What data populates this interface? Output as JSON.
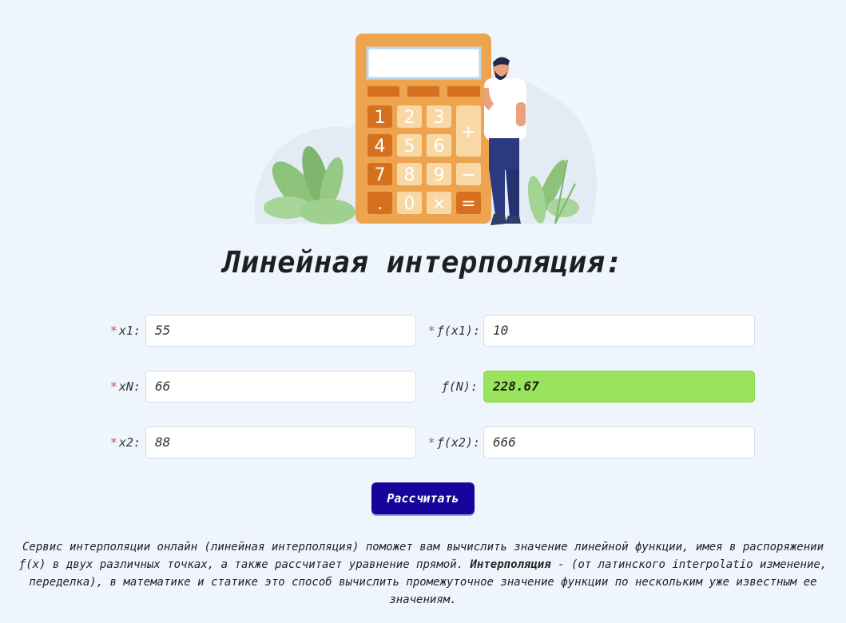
{
  "page": {
    "title": "Линейная интерполяция:"
  },
  "form": {
    "x1": {
      "label": "x1:",
      "required": "*",
      "value": "55"
    },
    "fx1": {
      "label": "ƒ(x1):",
      "required": "*",
      "value": "10"
    },
    "xN": {
      "label": "xN:",
      "required": "*",
      "value": "66"
    },
    "fN": {
      "label": "ƒ(N):",
      "value": "228.67"
    },
    "x2": {
      "label": "x2:",
      "required": "*",
      "value": "88"
    },
    "fx2": {
      "label": "ƒ(x2):",
      "required": "*",
      "value": "666"
    },
    "submit_label": "Рассчитать"
  },
  "calculator_keys": [
    "1",
    "2",
    "3",
    "+",
    "4",
    "5",
    "6",
    "7",
    "8",
    "9",
    "−",
    ".",
    "0",
    "×",
    "="
  ],
  "description": {
    "part1": "Сервис интерполяции онлайн (линейная интерполяция) поможет вам вычислить значение линейной функции, имея в распоряжении ƒ(x) в двух различных точках, а также рассчитает уравнение прямой. ",
    "bold": "Интерполяция",
    "part2": " - (от латинского interpolatio изменение, переделка), в математике и статике это способ вычислить промежуточное значение функции по нескольким уже известным ее значениям."
  },
  "colors": {
    "background": "#eff5fc",
    "button": "#17049b",
    "result": "#9ae35c",
    "required": "#e0464e",
    "calculator": "#eea44e"
  }
}
